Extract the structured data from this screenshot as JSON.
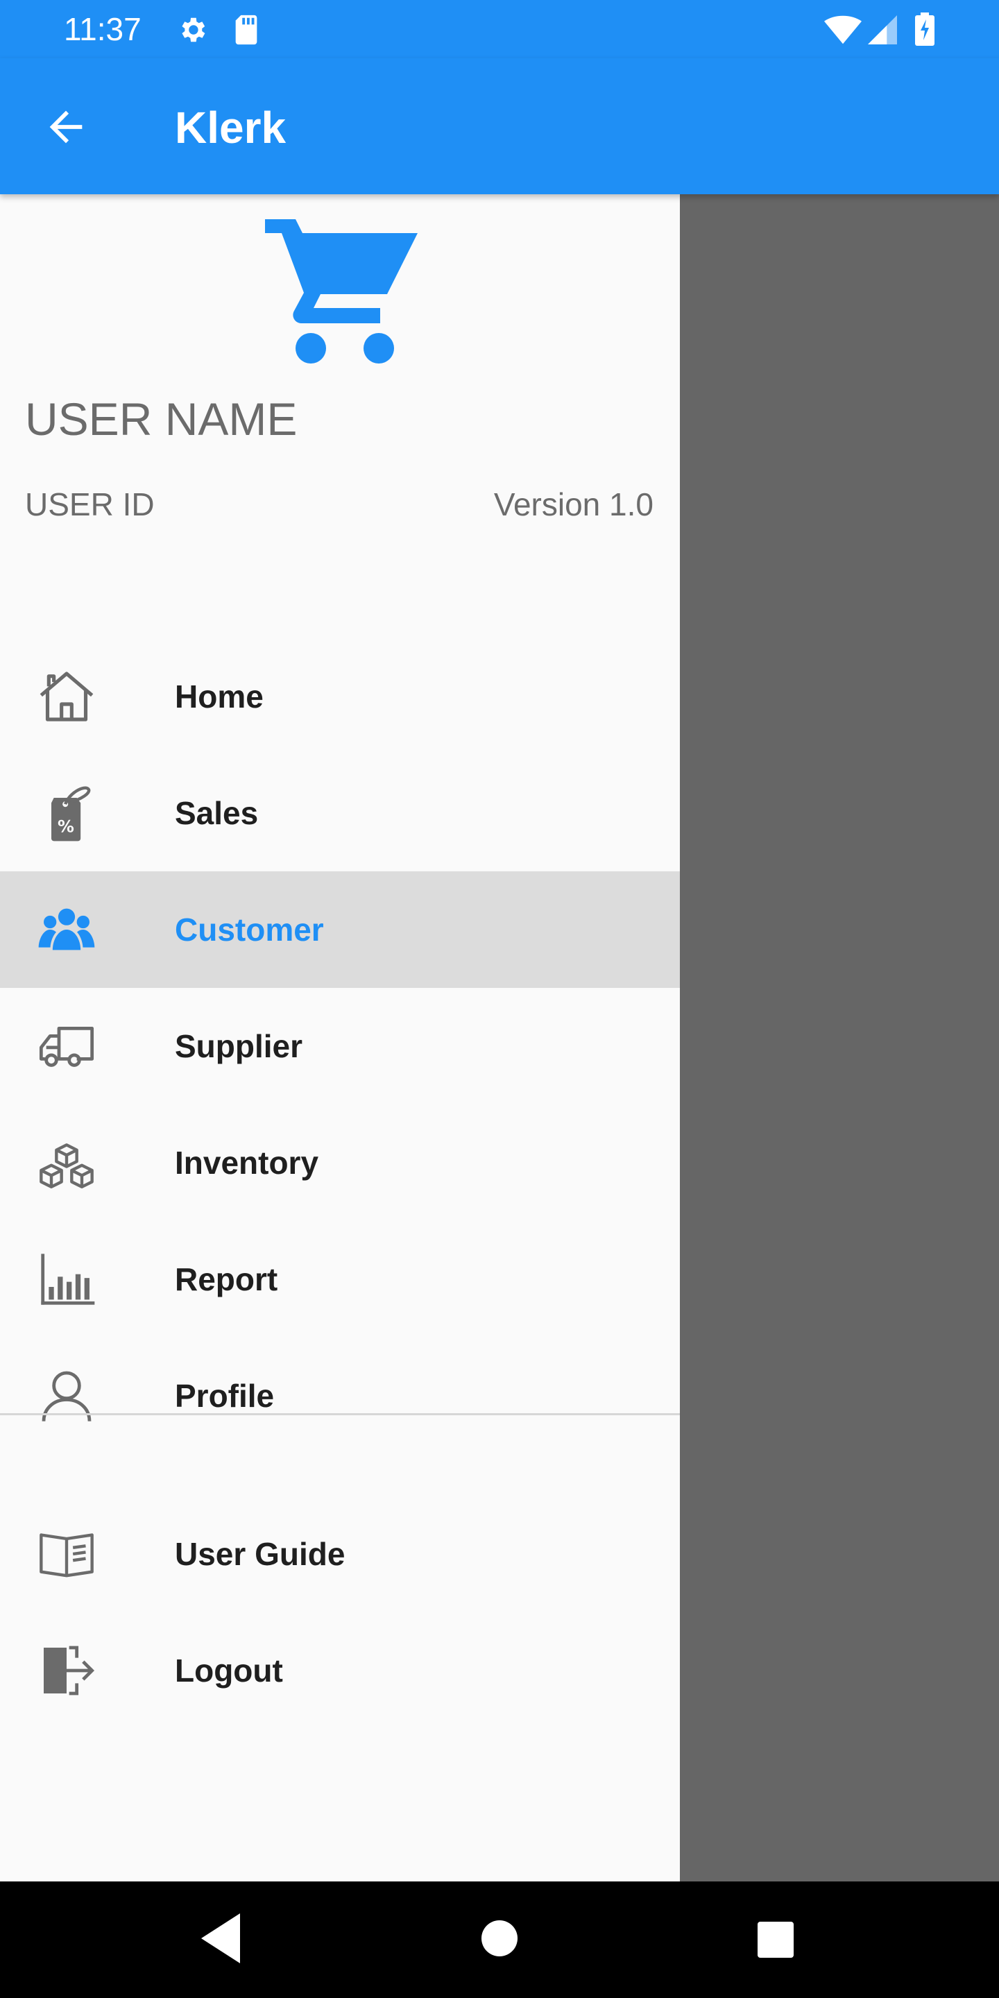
{
  "status_bar": {
    "time": "11:37",
    "icons": [
      "settings-gear-icon",
      "sd-card-icon",
      "wifi-icon",
      "cell-signal-icon",
      "battery-charging-icon"
    ]
  },
  "app_bar": {
    "title": "Klerk",
    "back_icon": "arrow-left-icon"
  },
  "drawer": {
    "logo_icon": "shopping-cart-icon",
    "user_name": "USER NAME",
    "user_id": "USER ID",
    "version": "Version 1.0",
    "primary_items": [
      {
        "label": "Home",
        "icon": "house-icon"
      },
      {
        "label": "Sales",
        "icon": "price-tag-percent-icon"
      },
      {
        "label": "Customer",
        "icon": "users-group-icon",
        "selected": true
      },
      {
        "label": "Supplier",
        "icon": "delivery-truck-icon"
      },
      {
        "label": "Inventory",
        "icon": "boxes-icon"
      },
      {
        "label": "Report",
        "icon": "bar-chart-icon"
      },
      {
        "label": "Profile",
        "icon": "person-icon"
      }
    ],
    "secondary_items": [
      {
        "label": "User Guide",
        "icon": "open-book-icon"
      },
      {
        "label": "Logout",
        "icon": "logout-door-icon"
      }
    ]
  },
  "navigation_bar": {
    "icons": [
      "nav-back-triangle-icon",
      "nav-home-circle-icon",
      "nav-recents-square-icon"
    ]
  },
  "colors": {
    "primary": "#1f8ff5",
    "drawer_background": "#fafafa",
    "selected_background": "#dcdcdc",
    "scrim": "#666666",
    "icon_gray": "#6b6b6b"
  }
}
